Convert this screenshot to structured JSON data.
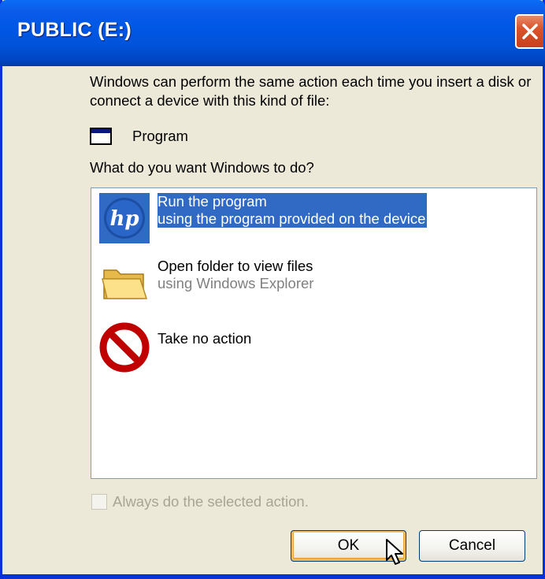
{
  "window": {
    "title": "PUBLIC (E:)"
  },
  "dialog": {
    "intro": "Windows can perform the same action each time you insert a disk or connect a device with this kind of file:",
    "content_type": "Program",
    "question": "What do you want Windows to do?",
    "options": [
      {
        "title": "Run the program",
        "subtitle": "using the program provided on the device",
        "icon": "hp-icon",
        "selected": true
      },
      {
        "title": "Open folder to view files",
        "subtitle": "using Windows Explorer",
        "icon": "folder-icon",
        "selected": false
      },
      {
        "title": "Take no action",
        "subtitle": "",
        "icon": "no-action-icon",
        "selected": false
      }
    ],
    "always_checkbox_label": "Always do the selected action.",
    "always_checked": false
  },
  "buttons": {
    "ok": "OK",
    "cancel": "Cancel"
  },
  "colors": {
    "titlebar": "#0058e6",
    "selection": "#316ac5",
    "dialog_bg": "#ece9d8",
    "close_button": "#d9532a"
  }
}
